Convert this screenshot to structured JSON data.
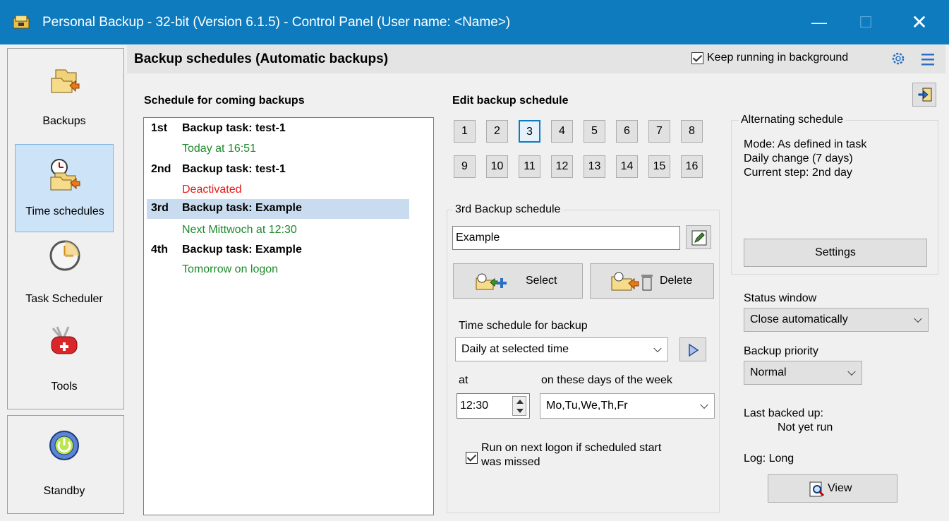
{
  "window": {
    "title": "Personal Backup - 32-bit (Version 6.1.5) - Control Panel (User name: <Name>)",
    "minimize": "—",
    "maximize": "☐",
    "close": "✕"
  },
  "sidebar": {
    "items": [
      {
        "label": "Backups",
        "icon": "backups-folder-icon",
        "active": false
      },
      {
        "label": "Time schedules",
        "icon": "time-schedules-icon",
        "active": true
      },
      {
        "label": "Task Scheduler",
        "icon": "clock-icon",
        "active": false
      },
      {
        "label": "Tools",
        "icon": "swiss-knife-icon",
        "active": false
      }
    ],
    "standby": {
      "label": "Standby",
      "icon": "power-icon"
    }
  },
  "header": {
    "title": "Backup schedules (Automatic backups)",
    "keep_running_label": "Keep running in background",
    "keep_running_checked": true
  },
  "schedule_list": {
    "title": "Schedule for coming backups",
    "items": [
      {
        "ordinal": "1st",
        "task": "Backup task: test-1",
        "detail": "Today at 16:51",
        "detail_color": "green",
        "selected": false
      },
      {
        "ordinal": "2nd",
        "task": "Backup task: test-1",
        "detail": "Deactivated",
        "detail_color": "red",
        "selected": false
      },
      {
        "ordinal": "3rd",
        "task": "Backup task: Example",
        "detail": "Next Mittwoch at 12:30",
        "detail_color": "green",
        "selected": true
      },
      {
        "ordinal": "4th",
        "task": "Backup task: Example",
        "detail": "Tomorrow on logon",
        "detail_color": "green",
        "selected": false
      }
    ]
  },
  "edit": {
    "title": "Edit backup schedule",
    "numbers": [
      "1",
      "2",
      "3",
      "4",
      "5",
      "6",
      "7",
      "8",
      "9",
      "10",
      "11",
      "12",
      "13",
      "14",
      "15",
      "16"
    ],
    "active_number": "3",
    "group_title": "3rd  Backup schedule",
    "name_value": "Example",
    "select_label": "Select",
    "delete_label": "Delete",
    "time_schedule_label": "Time schedule for backup",
    "time_schedule_value": "Daily at selected time",
    "at_label": "at",
    "days_label": "on these days of the week",
    "time_value": "12:30",
    "days_value": "Mo,Tu,We,Th,Fr",
    "run_missed_label_1": "Run on next logon if scheduled start",
    "run_missed_label_2": "was missed",
    "run_missed_checked": true
  },
  "alternating": {
    "title": "Alternating schedule",
    "mode": "Mode: As defined in task",
    "daily_change": "Daily change (7 days)",
    "current_step": "Current step: 2nd day",
    "settings_label": "Settings"
  },
  "status": {
    "status_window_label": "Status window",
    "status_window_value": "Close automatically",
    "priority_label": "Backup priority",
    "priority_value": "Normal",
    "last_backed_label": "Last backed up:",
    "last_backed_value": "Not yet run",
    "log_label": "Log: Long",
    "view_label": "View"
  }
}
